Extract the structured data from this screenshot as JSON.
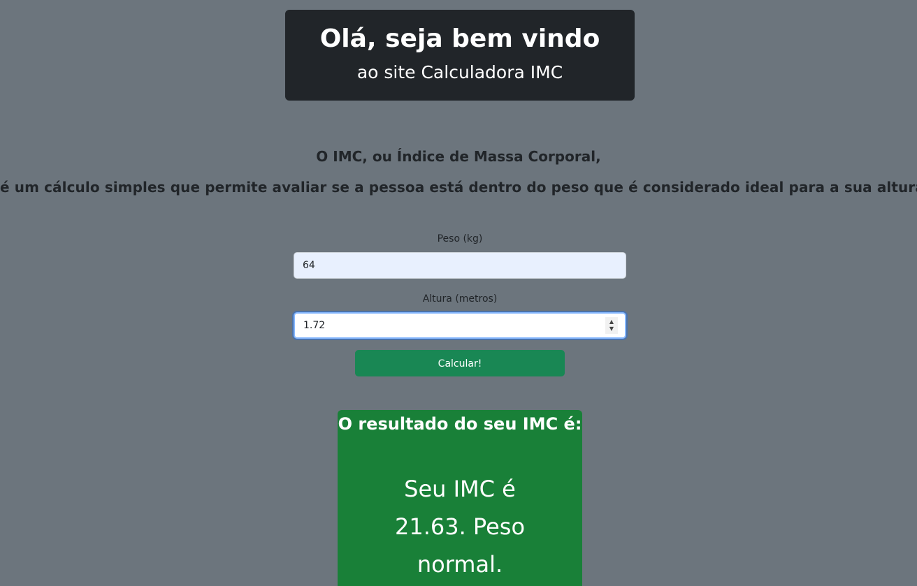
{
  "header": {
    "title": "Olá, seja bem vindo",
    "subtitle": "ao site Calculadora IMC"
  },
  "intro": {
    "line1": "O IMC, ou Índice de Massa Corporal,",
    "line2": "é um cálculo simples que permite avaliar se a pessoa está dentro do peso que é considerado ideal para a sua altura."
  },
  "form": {
    "peso_label": "Peso (kg)",
    "peso_value": "64",
    "altura_label": "Altura (metros)",
    "altura_value": "1.72",
    "submit_label": "Calcular!"
  },
  "result": {
    "heading": "O resultado do seu IMC é:",
    "text": "Seu IMC é 21.63. Peso normal."
  },
  "colors": {
    "background": "#6c757d",
    "header_bg": "#212529",
    "button_bg": "#198754",
    "result_bg": "#198038"
  }
}
